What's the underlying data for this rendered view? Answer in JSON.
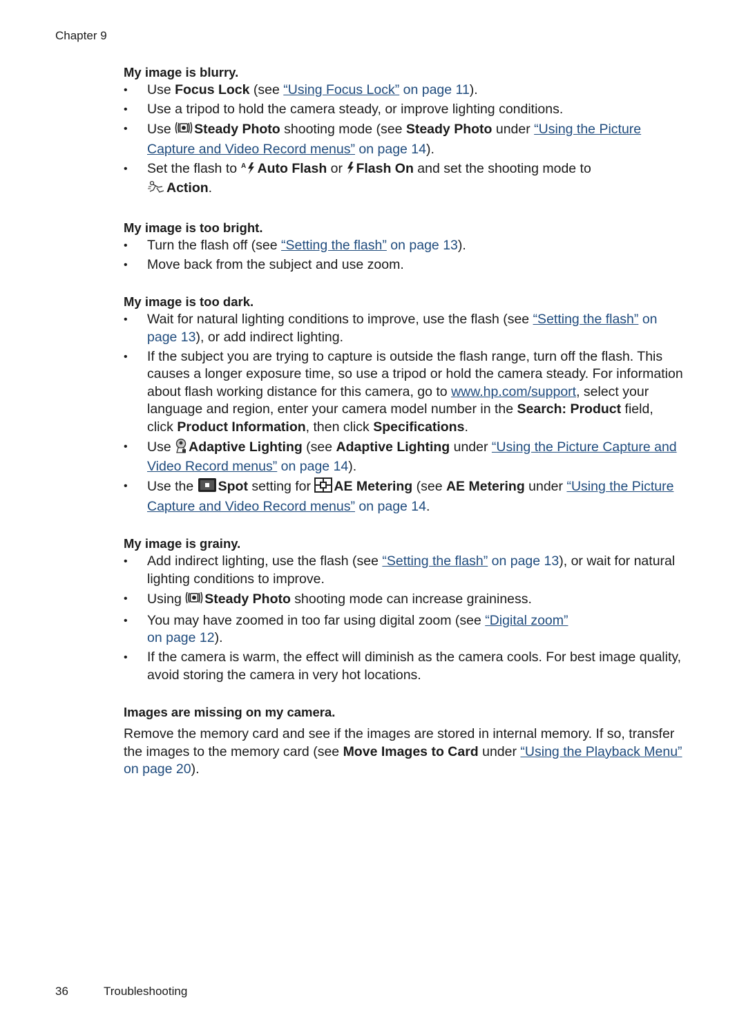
{
  "header": {
    "chapter": "Chapter 9"
  },
  "colors": {
    "link": "#1f4b7d",
    "text": "#1a1a1a"
  },
  "sections": {
    "blurry": {
      "title": "My image is blurry.",
      "b1": {
        "t1": "Use ",
        "bold1": "Focus Lock",
        "t2": " (see ",
        "link": "“Using Focus Lock”",
        "ref": " on page 11",
        "t3": ")."
      },
      "b2": {
        "t1": "Use a tripod to hold the camera steady, or improve lighting conditions."
      },
      "b3": {
        "t1": "Use ",
        "icon": "steady-photo-icon",
        "bold1": "Steady Photo",
        "t2": " shooting mode (see ",
        "bold2": "Steady Photo",
        "t3": " under ",
        "link": "“Using the Picture Capture and Video Record menus”",
        "ref": " on page 14",
        "t4": ")."
      },
      "b4": {
        "t1": "Set the flash to ",
        "icon1": "auto-flash-icon",
        "bold1": "Auto Flash",
        "t2": " or ",
        "icon2": "flash-on-icon",
        "bold2": "Flash On",
        "t3": " and set the shooting mode to ",
        "icon3": "action-mode-icon",
        "bold3": "Action",
        "t4": "."
      }
    },
    "bright": {
      "title": "My image is too bright.",
      "b1": {
        "t1": "Turn the flash off (see ",
        "link": "“Setting the flash”",
        "ref": " on page 13",
        "t2": ")."
      },
      "b2": {
        "t1": "Move back from the subject and use zoom."
      }
    },
    "dark": {
      "title": "My image is too dark.",
      "b1": {
        "t1": "Wait for natural lighting conditions to improve, use the flash (see ",
        "link": "“Setting the flash”",
        "ref": " on page 13",
        "t2": "), or add indirect lighting."
      },
      "b2": {
        "t1": "If the subject you are trying to capture is outside the flash range, turn off the flash. This causes a longer exposure time, so use a tripod or hold the camera steady. For information about flash working distance for this camera, go to ",
        "link": "www.hp.com/support",
        "t2": ", select your language and region, enter your camera model number in the ",
        "bold1": "Search: Product",
        "t3": " field, click ",
        "bold2": "Product Information",
        "t4": ", then click ",
        "bold3": "Specifications",
        "t5": "."
      },
      "b3": {
        "t1": "Use ",
        "icon": "adaptive-lighting-icon",
        "bold1": "Adaptive Lighting",
        "t2": " (see ",
        "bold2": "Adaptive Lighting",
        "t3": " under ",
        "link": "“Using the Picture Capture and Video Record menus”",
        "ref": " on page 14",
        "t4": ")."
      },
      "b4": {
        "t1": "Use the ",
        "icon1": "spot-metering-icon",
        "bold1": "Spot",
        "t2": " setting for ",
        "icon2": "ae-metering-icon",
        "bold2": "AE Metering",
        "t3": " (see ",
        "bold3": "AE Metering",
        "t4": " under ",
        "link": "“Using the Picture Capture and Video Record menus”",
        "ref": " on page 14",
        "t5": "."
      }
    },
    "grainy": {
      "title": "My image is grainy.",
      "b1": {
        "t1": "Add indirect lighting, use the flash (see ",
        "link": "“Setting the flash”",
        "ref": " on page 13",
        "t2": "), or wait for natural lighting conditions to improve."
      },
      "b2": {
        "t1": "Using ",
        "icon": "steady-photo-icon",
        "bold1": "Steady Photo",
        "t2": " shooting mode can increase graininess."
      },
      "b3": {
        "t1": "You may have zoomed in too far using digital zoom (see ",
        "link": "“Digital zoom”",
        "ref": " on page 12",
        "t2": ")."
      },
      "b4": {
        "t1": "If the camera is warm, the effect will diminish as the camera cools. For best image quality, avoid storing the camera in very hot locations."
      }
    },
    "missing": {
      "title": "Images are missing on my camera.",
      "p": {
        "t1": "Remove the memory card and see if the images are stored in internal memory. If so, transfer the images to the memory card (see ",
        "bold1": "Move Images to Card",
        "t2": " under ",
        "link": "“Using the Playback Menu”",
        "ref": " on page 20",
        "t3": ")."
      }
    }
  },
  "footer": {
    "page_number": "36",
    "section": "Troubleshooting"
  }
}
